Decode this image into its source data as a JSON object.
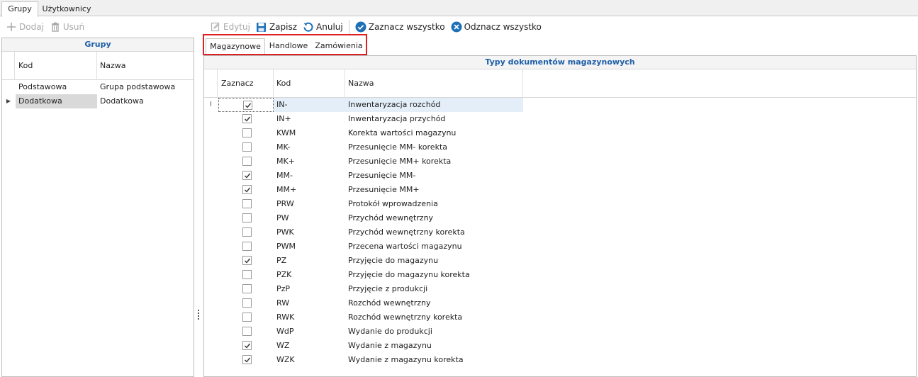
{
  "top_tabs": [
    {
      "label": "Grupy",
      "active": true
    },
    {
      "label": "Użytkownicy",
      "active": false
    }
  ],
  "left_toolbar": {
    "add_label": "Dodaj",
    "remove_label": "Usuń"
  },
  "right_toolbar": {
    "edit_label": "Edytuj",
    "save_label": "Zapisz",
    "cancel_label": "Anuluj",
    "select_all_label": "Zaznacz wszystko",
    "deselect_all_label": "Odznacz wszystko"
  },
  "groups_grid": {
    "caption": "Grupy",
    "columns": {
      "kod": "Kod",
      "nazwa": "Nazwa"
    },
    "rows": [
      {
        "kod": "Podstawowa",
        "nazwa": "Grupa podstawowa",
        "selected": false
      },
      {
        "kod": "Dodatkowa",
        "nazwa": "Dodatkowa",
        "selected": true
      }
    ]
  },
  "doc_tabs": [
    {
      "label": "Magazynowe",
      "active": true
    },
    {
      "label": "Handlowe",
      "active": false
    },
    {
      "label": "Zamówienia",
      "active": false
    }
  ],
  "doc_grid": {
    "caption": "Typy dokumentów magazynowych",
    "columns": {
      "zaznacz": "Zaznacz",
      "kod": "Kod",
      "nazwa": "Nazwa"
    },
    "rows": [
      {
        "checked": true,
        "kod": "IN-",
        "nazwa": "Inwentaryzacja rozchód"
      },
      {
        "checked": true,
        "kod": "IN+",
        "nazwa": "Inwentaryzacja przychód"
      },
      {
        "checked": false,
        "kod": "KWM",
        "nazwa": "Korekta wartości magazynu"
      },
      {
        "checked": false,
        "kod": "MK-",
        "nazwa": "Przesunięcie MM- korekta"
      },
      {
        "checked": false,
        "kod": "MK+",
        "nazwa": "Przesunięcie MM+ korekta"
      },
      {
        "checked": true,
        "kod": "MM-",
        "nazwa": "Przesunięcie MM-"
      },
      {
        "checked": true,
        "kod": "MM+",
        "nazwa": "Przesunięcie MM+"
      },
      {
        "checked": false,
        "kod": "PRW",
        "nazwa": "Protokół wprowadzenia"
      },
      {
        "checked": false,
        "kod": "PW",
        "nazwa": "Przychód wewnętrzny"
      },
      {
        "checked": false,
        "kod": "PWK",
        "nazwa": "Przychód wewnętrzny korekta"
      },
      {
        "checked": false,
        "kod": "PWM",
        "nazwa": "Przecena wartości magazynu"
      },
      {
        "checked": true,
        "kod": "PZ",
        "nazwa": "Przyjęcie do magazynu"
      },
      {
        "checked": false,
        "kod": "PZK",
        "nazwa": "Przyjęcie do magazynu korekta"
      },
      {
        "checked": false,
        "kod": "PzP",
        "nazwa": "Przyjęcie z produkcji"
      },
      {
        "checked": false,
        "kod": "RW",
        "nazwa": "Rozchód wewnętrzny"
      },
      {
        "checked": false,
        "kod": "RWK",
        "nazwa": "Rozchód wewnętrzny korekta"
      },
      {
        "checked": false,
        "kod": "WdP",
        "nazwa": "Wydanie do produkcji"
      },
      {
        "checked": true,
        "kod": "WZ",
        "nazwa": "Wydanie z magazynu"
      },
      {
        "checked": true,
        "kod": "WZK",
        "nazwa": "Wydanie z magazynu korekta"
      }
    ]
  },
  "colors": {
    "caption_blue": "#1f5fa8",
    "accent_blue": "#1d6fb8",
    "highlight_red": "#e02020",
    "focus_row": "#e4eef8"
  }
}
